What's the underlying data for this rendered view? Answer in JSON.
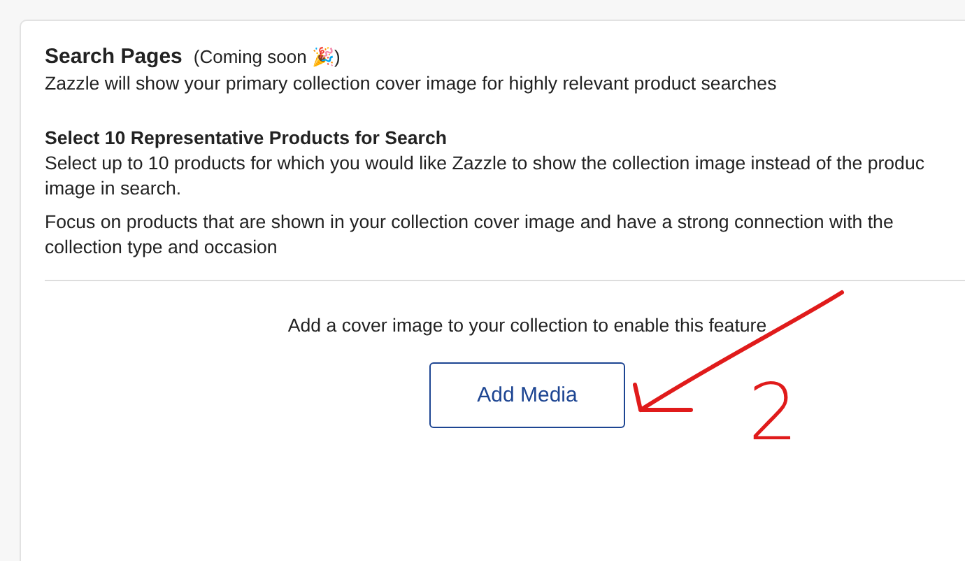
{
  "section": {
    "title": "Search Pages",
    "note": "(Coming soon 🎉)",
    "description": "Zazzle will show your primary collection cover image for highly relevant product searches"
  },
  "products": {
    "heading": "Select 10 Representative Products for Search",
    "paragraphs": [
      {
        "lines": [
          "Select up to 10 products for which you would like Zazzle to show the collection image instead of the produc",
          "image in search."
        ]
      },
      {
        "lines": [
          "Focus on products that are shown in your collection cover image and have a strong connection with the",
          "collection type and occasion"
        ]
      }
    ]
  },
  "empty_state": {
    "message": "Add a cover image to your collection to enable this feature",
    "button": "Add Media"
  },
  "annotation": {
    "label": "2"
  }
}
